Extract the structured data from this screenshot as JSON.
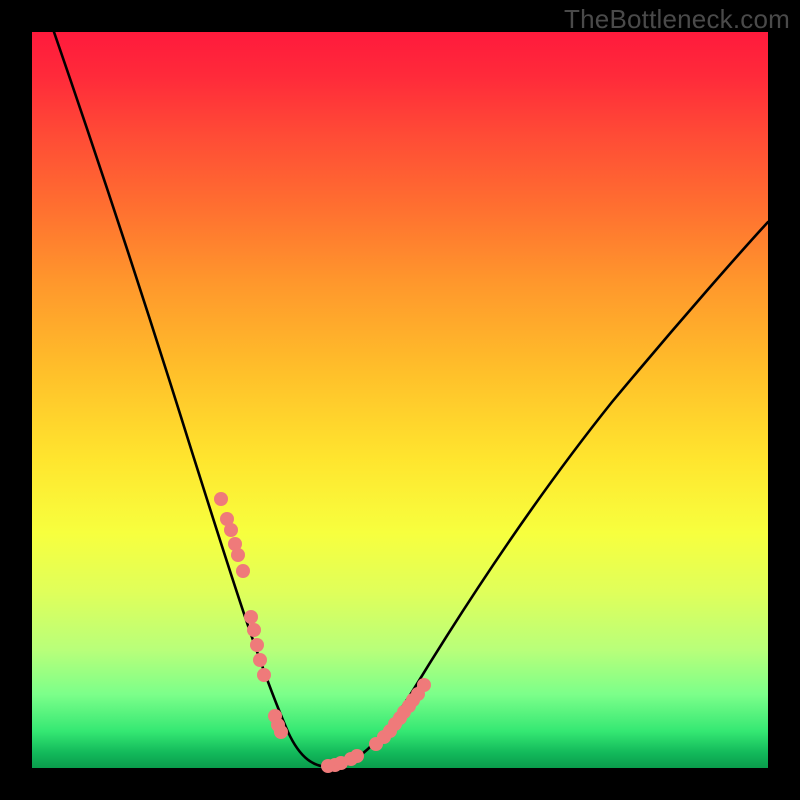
{
  "watermark": "TheBottleneck.com",
  "chart_data": {
    "type": "line",
    "title": "",
    "xlabel": "",
    "ylabel": "",
    "xlim": [
      0,
      100
    ],
    "ylim": [
      0,
      100
    ],
    "grid": false,
    "legend": false,
    "background_gradient": {
      "direction": "vertical",
      "stops": [
        {
          "pos": 0,
          "color": "#ff1a3c"
        },
        {
          "pos": 50,
          "color": "#ffe52e"
        },
        {
          "pos": 100,
          "color": "#0a9c4c"
        }
      ]
    },
    "series": [
      {
        "name": "bottleneck-curve",
        "color": "#000000",
        "x": [
          3,
          6,
          10,
          14,
          18,
          22,
          25,
          28,
          30,
          32,
          34,
          36,
          38,
          42,
          46,
          50,
          55,
          60,
          66,
          72,
          80,
          88,
          96,
          100
        ],
        "y": [
          100,
          93,
          83,
          72,
          61,
          49,
          39,
          28,
          19,
          10,
          4,
          1,
          0,
          0,
          2,
          6,
          12,
          19,
          27,
          35,
          45,
          54,
          62,
          66
        ]
      },
      {
        "name": "highlight-dots-left",
        "color": "#ef7a7a",
        "type": "scatter",
        "x": [
          25.5,
          26.3,
          26.8,
          27.4,
          27.8,
          28.4,
          29.6,
          30.0,
          30.4,
          30.8,
          31.3,
          32.8,
          33.2,
          33.6
        ],
        "y": [
          36.5,
          33.8,
          32.4,
          30.4,
          29.0,
          26.8,
          20.6,
          18.8,
          16.8,
          14.8,
          12.8,
          7.2,
          6.0,
          5.0
        ]
      },
      {
        "name": "highlight-dots-right",
        "color": "#ef7a7a",
        "type": "scatter",
        "x": [
          40.0,
          41.0,
          41.8,
          43.2,
          44.0,
          46.6,
          47.6,
          48.4,
          49.2,
          49.8,
          50.4,
          51.0,
          51.6,
          52.2,
          53.0
        ],
        "y": [
          0.4,
          0.6,
          0.8,
          1.4,
          1.8,
          3.4,
          4.4,
          5.2,
          6.2,
          7.0,
          7.8,
          8.6,
          9.4,
          10.2,
          11.4
        ]
      }
    ]
  }
}
